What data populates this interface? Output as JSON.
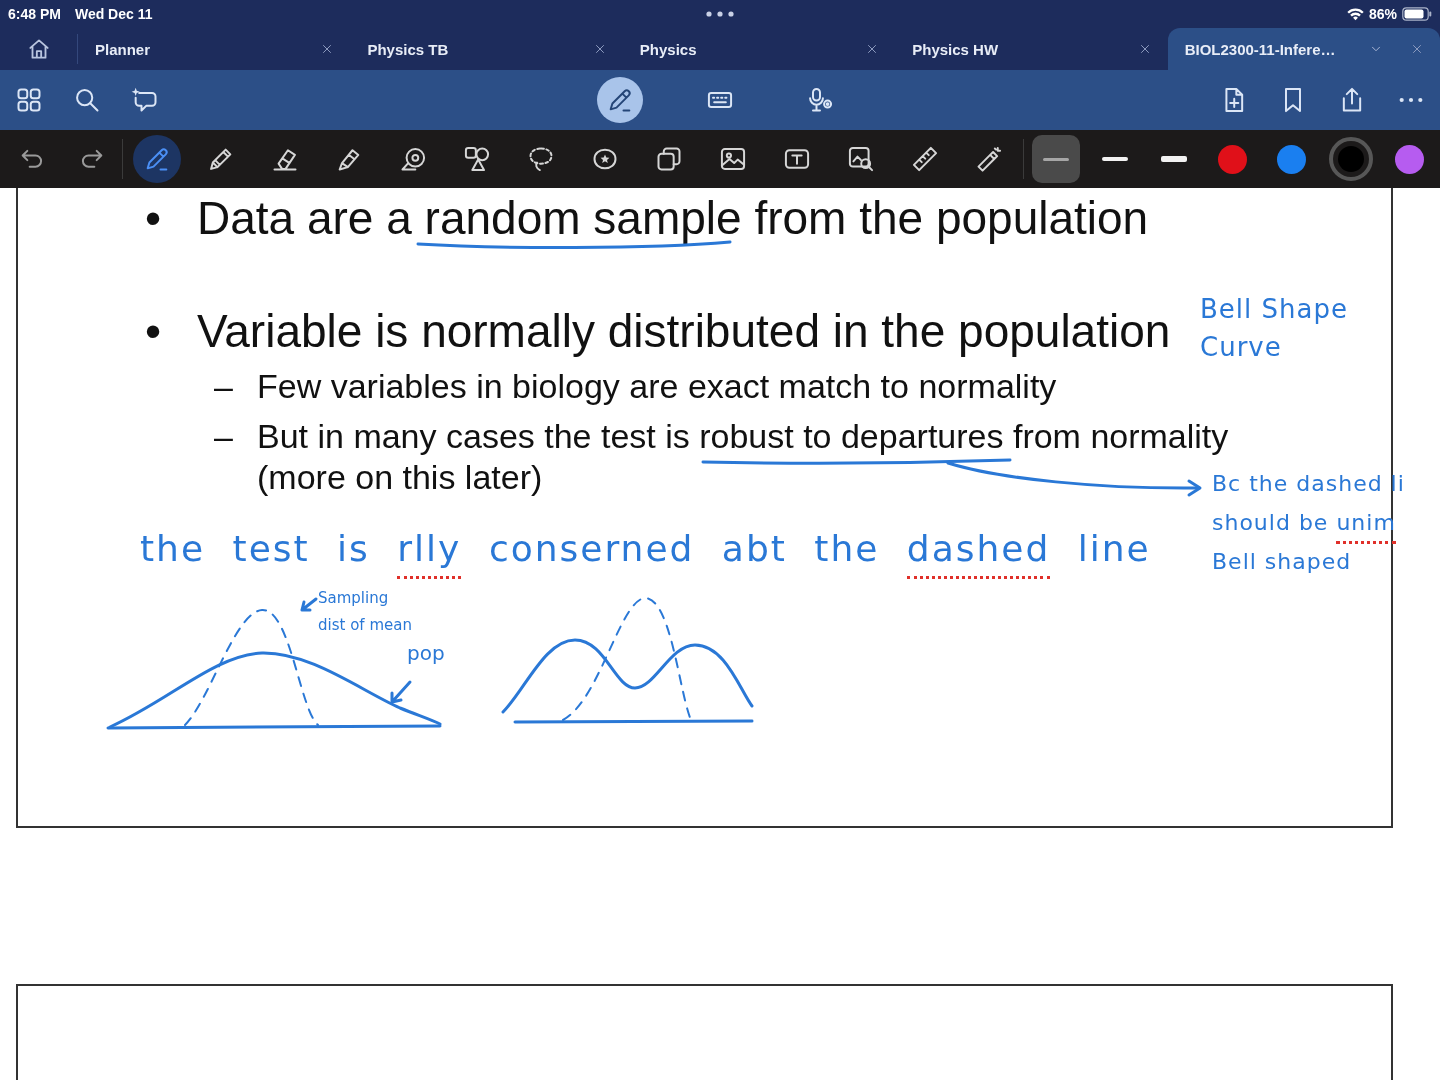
{
  "status_bar": {
    "time": "6:48 PM",
    "date": "Wed Dec 11",
    "battery": "86%"
  },
  "tabs": [
    {
      "label": "Planner",
      "selected": false
    },
    {
      "label": "Physics TB",
      "selected": false
    },
    {
      "label": "Physics",
      "selected": false
    },
    {
      "label": "Physics HW",
      "selected": false
    },
    {
      "label": "BIOL2300-11-Infere…",
      "selected": true
    }
  ],
  "modes": [
    {
      "kind": "handwriting",
      "selected": true
    },
    {
      "kind": "keyboard",
      "selected": false
    },
    {
      "kind": "audio",
      "selected": false
    }
  ],
  "tools": [
    {
      "kind": "pen",
      "selected": true
    },
    {
      "kind": "pencil",
      "selected": false
    },
    {
      "kind": "eraser",
      "selected": false
    },
    {
      "kind": "highlighter",
      "selected": false
    },
    {
      "kind": "tape",
      "selected": false
    },
    {
      "kind": "shapes",
      "selected": false
    },
    {
      "kind": "lasso",
      "selected": false
    },
    {
      "kind": "sticker",
      "selected": false
    },
    {
      "kind": "elements",
      "selected": false
    },
    {
      "kind": "image",
      "selected": false
    },
    {
      "kind": "text",
      "selected": false
    },
    {
      "kind": "scan",
      "selected": false
    },
    {
      "kind": "ruler",
      "selected": false
    },
    {
      "kind": "laser",
      "selected": false
    }
  ],
  "stroke_sizes": [
    {
      "kind": "thin",
      "selected": true
    },
    {
      "kind": "medium",
      "selected": false
    },
    {
      "kind": "thick",
      "selected": false
    }
  ],
  "colors": [
    {
      "color": "#e01019",
      "selected": false
    },
    {
      "color": "#1a7ff0",
      "selected": false
    },
    {
      "color": "#000000",
      "selected": true
    },
    {
      "color": "#b65cf0",
      "selected": false
    }
  ],
  "page": {
    "bullets": [
      {
        "marker": "•",
        "lines": [
          "Data are a random sample from the population"
        ]
      },
      {
        "marker": "•",
        "lines": [
          "Variable is normally distributed in the population"
        ],
        "children": [
          {
            "marker": "–",
            "lines": [
              "Few variables in biology are exact match to normality"
            ]
          },
          {
            "marker": "–",
            "lines": [
              "But in many cases the test is robust to departures from normality",
              "(more on this later)"
            ]
          }
        ]
      }
    ]
  },
  "ink_notes": [
    {
      "lines": [
        [
          {
            "text": "Bell Shape",
            "flagged": false
          }
        ],
        [
          {
            "text": "Curve",
            "flagged": false
          }
        ]
      ]
    },
    {
      "lines": [
        [
          {
            "text": "the test is",
            "flagged": false
          },
          {
            "text": "rlly",
            "flagged": true
          },
          {
            "text": "conserned abt the",
            "flagged": false
          },
          {
            "text": "dashed",
            "flagged": true
          },
          {
            "text": "line",
            "flagged": false
          }
        ]
      ]
    },
    {
      "lines": [
        [
          {
            "text": "Bc the dashed li",
            "flagged": false
          }
        ],
        [
          {
            "text": "should be",
            "flagged": false
          },
          {
            "text": "unim",
            "flagged": true
          }
        ],
        [
          {
            "text": "Bell shaped",
            "flagged": false
          }
        ]
      ]
    },
    {
      "lines": [
        [
          {
            "text": "Sampling",
            "flagged": false
          }
        ],
        [
          {
            "text": "dist of mean",
            "flagged": false
          }
        ]
      ]
    },
    {
      "lines": [
        [
          {
            "text": "pop",
            "flagged": false
          }
        ]
      ]
    }
  ]
}
